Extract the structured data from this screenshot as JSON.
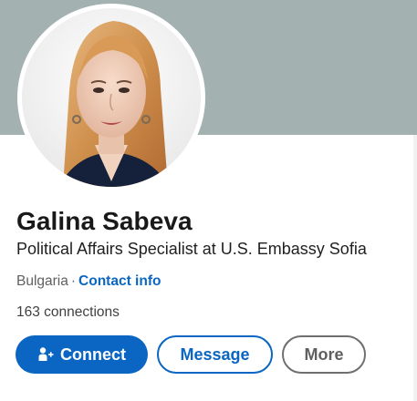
{
  "profile": {
    "name": "Galina Sabeva",
    "headline": "Political Affairs Specialist at U.S. Embassy Sofia",
    "location": "Bulgaria",
    "separator": "·",
    "contact_info_label": "Contact info",
    "connections": "163 connections"
  },
  "actions": {
    "connect_label": "Connect",
    "message_label": "Message",
    "more_label": "More"
  },
  "colors": {
    "banner": "#a3b1b1",
    "accent": "#0a66c2"
  },
  "icons": {
    "connect": "add-person-icon"
  }
}
